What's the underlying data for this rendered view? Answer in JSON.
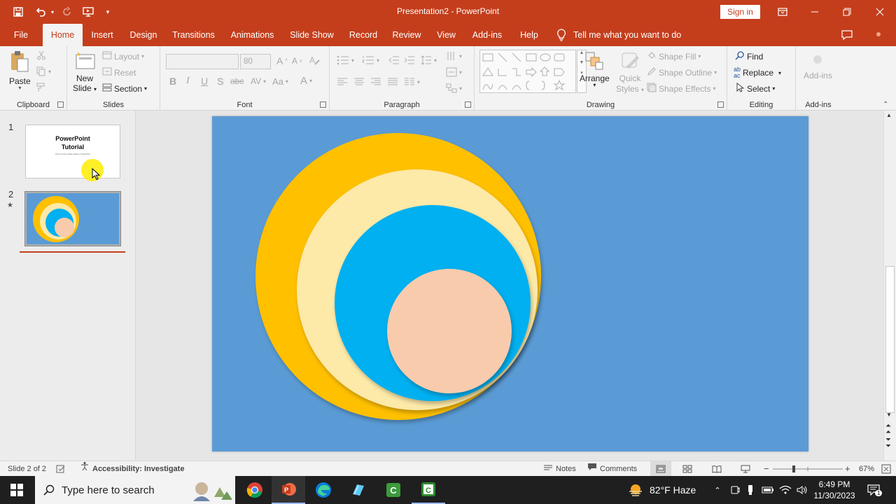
{
  "window": {
    "title": "Presentation2  -  PowerPoint",
    "signin": "Sign in"
  },
  "tabs": [
    {
      "label": "File"
    },
    {
      "label": "Home"
    },
    {
      "label": "Insert"
    },
    {
      "label": "Design"
    },
    {
      "label": "Transitions"
    },
    {
      "label": "Animations"
    },
    {
      "label": "Slide Show"
    },
    {
      "label": "Record"
    },
    {
      "label": "Review"
    },
    {
      "label": "View"
    },
    {
      "label": "Add-ins"
    },
    {
      "label": "Help"
    }
  ],
  "tell_me": "Tell me what you want to do",
  "ribbon": {
    "clipboard": {
      "label": "Clipboard",
      "paste": "Paste"
    },
    "slides": {
      "label": "Slides",
      "new_slide_1": "New",
      "new_slide_2": "Slide",
      "layout": "Layout",
      "reset": "Reset",
      "section": "Section"
    },
    "font": {
      "label": "Font",
      "size": "80"
    },
    "paragraph": {
      "label": "Paragraph"
    },
    "drawing": {
      "label": "Drawing",
      "arrange": "Arrange",
      "quick_1": "Quick",
      "quick_2": "Styles",
      "shape_fill": "Shape Fill",
      "shape_outline": "Shape Outline",
      "shape_effects": "Shape Effects"
    },
    "editing": {
      "label": "Editing",
      "find": "Find",
      "replace": "Replace",
      "select": "Select"
    },
    "addins": {
      "label": "Add-ins",
      "addins_btn": "Add-ins"
    }
  },
  "thumbnails": [
    {
      "number": "1",
      "title_line1": "PowerPoint",
      "title_line2": "Tutorial",
      "subtitle": "How to Group multiple shapes in PowerPoint"
    },
    {
      "number": "2",
      "star": "★"
    }
  ],
  "status": {
    "slide": "Slide 2 of 2",
    "accessibility": "Accessibility: Investigate",
    "notes": "Notes",
    "comments": "Comments",
    "zoom": "67%"
  },
  "taskbar": {
    "search_placeholder": "Type here to search",
    "weather": "82°F  Haze",
    "time": "6:49 PM",
    "date": "11/30/2023"
  },
  "colors": {
    "accent": "#c43e1c",
    "slide_bg": "#5b9bd5",
    "circle_gold": "#ffc000",
    "circle_cream": "#fde9a8",
    "circle_cyan": "#00b0f0",
    "circle_peach": "#f8cbad"
  }
}
